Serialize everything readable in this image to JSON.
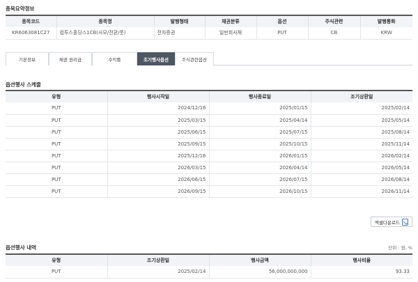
{
  "summary": {
    "title": "종목요약정보",
    "headers": [
      "종목코드",
      "종목명",
      "발행형태",
      "채권분류",
      "옵션",
      "주식관련",
      "발행통화"
    ],
    "row": [
      "KR6063081C27",
      "컴투스홀딩스1CB(사모/전환/풋)",
      "전자증권",
      "일반회사채",
      "PUT",
      "CB",
      "KRW"
    ]
  },
  "tabs": [
    {
      "label": "기본정보",
      "active": false
    },
    {
      "label": "채권 원리금",
      "active": false
    },
    {
      "label": "수익률",
      "active": false
    },
    {
      "label": "조기행사옵션",
      "active": true
    },
    {
      "label": "주식관련옵션",
      "active": false
    }
  ],
  "schedule": {
    "title": "옵션행사 스케줄",
    "headers": [
      "유형",
      "행사시작일",
      "행사종료일",
      "조기상환일"
    ],
    "rows": [
      [
        "PUT",
        "2024/12/16",
        "2025/01/15",
        "2025/02/14"
      ],
      [
        "PUT",
        "2025/03/15",
        "2025/04/14",
        "2025/05/14"
      ],
      [
        "PUT",
        "2025/06/15",
        "2025/07/15",
        "2025/08/14"
      ],
      [
        "PUT",
        "2025/09/15",
        "2025/10/15",
        "2025/11/14"
      ],
      [
        "PUT",
        "2025/12/16",
        "2026/01/15",
        "2026/02/14"
      ],
      [
        "PUT",
        "2026/03/15",
        "2026/04/14",
        "2026/05/14"
      ],
      [
        "PUT",
        "2026/06/15",
        "2026/07/15",
        "2026/08/14"
      ],
      [
        "PUT",
        "2026/09/15",
        "2026/10/15",
        "2026/11/14"
      ]
    ],
    "excel_label": "엑셀다운로드"
  },
  "history": {
    "title": "옵션행사 내역",
    "unit": "단위 : 원, %",
    "headers": [
      "유형",
      "조기상환일",
      "행사금액",
      "행사비율"
    ],
    "rows": [
      [
        "PUT",
        "2025/02/14",
        "56,000,000,000",
        "93.33"
      ]
    ]
  },
  "colors": {
    "active_tab_bg": "#4d5661",
    "header_bg": "#f1f3f6",
    "table_top_border": "#555555"
  },
  "icons": {
    "excel": "excel-download-icon"
  }
}
